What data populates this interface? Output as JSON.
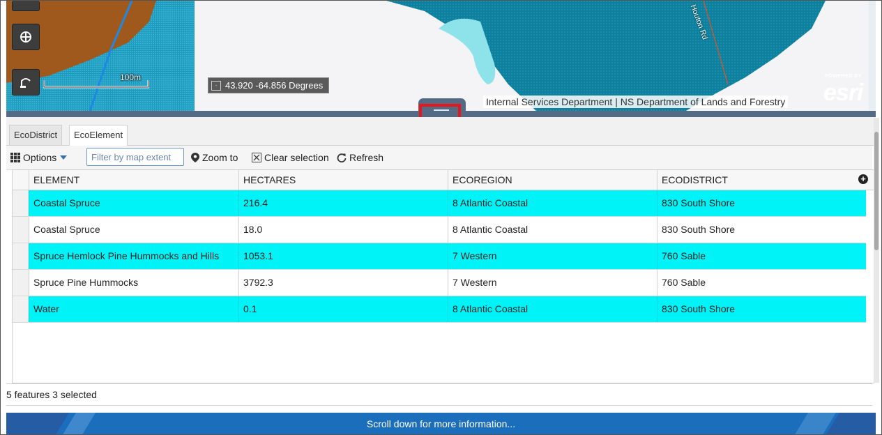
{
  "map": {
    "coordinates": "43.920 -64.856 Degrees",
    "scale_label": "100m",
    "road_label": "Houton Rd",
    "attribution": "Internal Services Department | NS Department of Lands and Forestry",
    "esri_powered_by": "POWERED BY",
    "esri_logo": "esri"
  },
  "tabs": [
    {
      "label": "EcoDistrict",
      "active": false
    },
    {
      "label": "EcoElement",
      "active": true
    }
  ],
  "toolbar": {
    "options_label": "Options",
    "filter_placeholder": "Filter by map extent",
    "zoom_label": "Zoom to",
    "clear_label": "Clear selection",
    "refresh_label": "Refresh"
  },
  "table": {
    "columns": [
      "ELEMENT",
      "HECTARES",
      "ECOREGION",
      "ECODISTRICT"
    ],
    "rows": [
      {
        "element": "Coastal Spruce",
        "hectares": "216.4",
        "ecoregion": "8 Atlantic Coastal",
        "ecodistrict": "830 South Shore",
        "selected": true
      },
      {
        "element": "Coastal Spruce",
        "hectares": "18.0",
        "ecoregion": "8 Atlantic Coastal",
        "ecodistrict": "830 South Shore",
        "selected": false
      },
      {
        "element": "Spruce Hemlock Pine Hummocks and Hills",
        "hectares": "1053.1",
        "ecoregion": "7 Western",
        "ecodistrict": "760 Sable",
        "selected": true
      },
      {
        "element": "Spruce Pine Hummocks",
        "hectares": "3792.3",
        "ecoregion": "7 Western",
        "ecodistrict": "760 Sable",
        "selected": false
      },
      {
        "element": "Water",
        "hectares": "0.1",
        "ecoregion": "8 Atlantic Coastal",
        "ecodistrict": "830 South Shore",
        "selected": true
      }
    ]
  },
  "status": "5 features  3 selected",
  "banner_text": "Scroll down for more information...",
  "colors": {
    "selected_row": "#00f3f7",
    "splitter": "#556a85",
    "banner": "#1a6ebc",
    "highlight": "#e8151b",
    "map_land": "#a0591c",
    "map_water": "#0e7f9c"
  },
  "icons": [
    "legend-icon",
    "measure-icon",
    "grid-icon",
    "caret-down-icon",
    "pin-icon",
    "clear-box-icon",
    "refresh-icon",
    "add-column-icon"
  ]
}
